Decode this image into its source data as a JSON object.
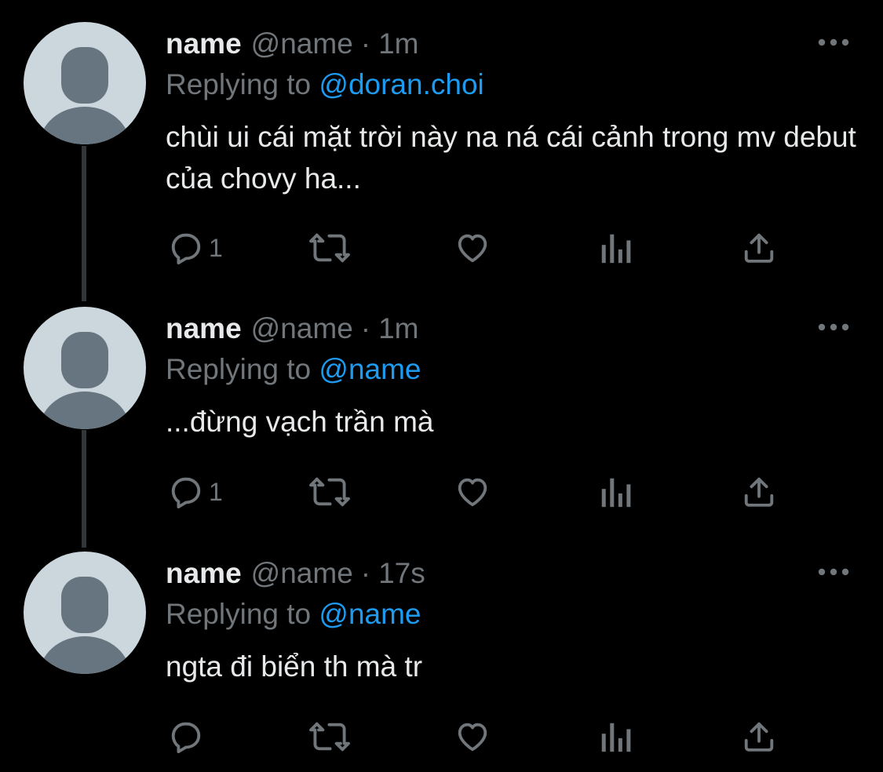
{
  "colors": {
    "background": "#000000",
    "primary_text": "#e7e9ea",
    "secondary_text": "#71767b",
    "link": "#1d9bf0",
    "avatar_bg": "#ccd6dd",
    "avatar_figure": "#66757f",
    "thread_line": "#333639"
  },
  "tweets": [
    {
      "display_name": "name",
      "handle": "@name",
      "separator": "·",
      "time": "1m",
      "replying_prefix": "Replying to",
      "replying_to": "@doran.choi",
      "text": "chùi ui cái mặt trời này na ná cái cảnh trong mv debut của chovy ha...",
      "reply_count": "1",
      "icons": [
        "more-icon",
        "reply-icon",
        "retweet-icon",
        "like-icon",
        "analytics-icon",
        "share-icon"
      ]
    },
    {
      "display_name": "name",
      "handle": "@name",
      "separator": "·",
      "time": "1m",
      "replying_prefix": "Replying to",
      "replying_to": "@name",
      "text": "...đừng vạch trần mà",
      "reply_count": "1",
      "icons": [
        "more-icon",
        "reply-icon",
        "retweet-icon",
        "like-icon",
        "analytics-icon",
        "share-icon"
      ]
    },
    {
      "display_name": "name",
      "handle": "@name",
      "separator": "·",
      "time": "17s",
      "replying_prefix": "Replying to",
      "replying_to": "@name",
      "text": "ngta đi biển th mà tr",
      "reply_count": "",
      "icons": [
        "more-icon",
        "reply-icon",
        "retweet-icon",
        "like-icon",
        "analytics-icon",
        "share-icon"
      ]
    }
  ]
}
